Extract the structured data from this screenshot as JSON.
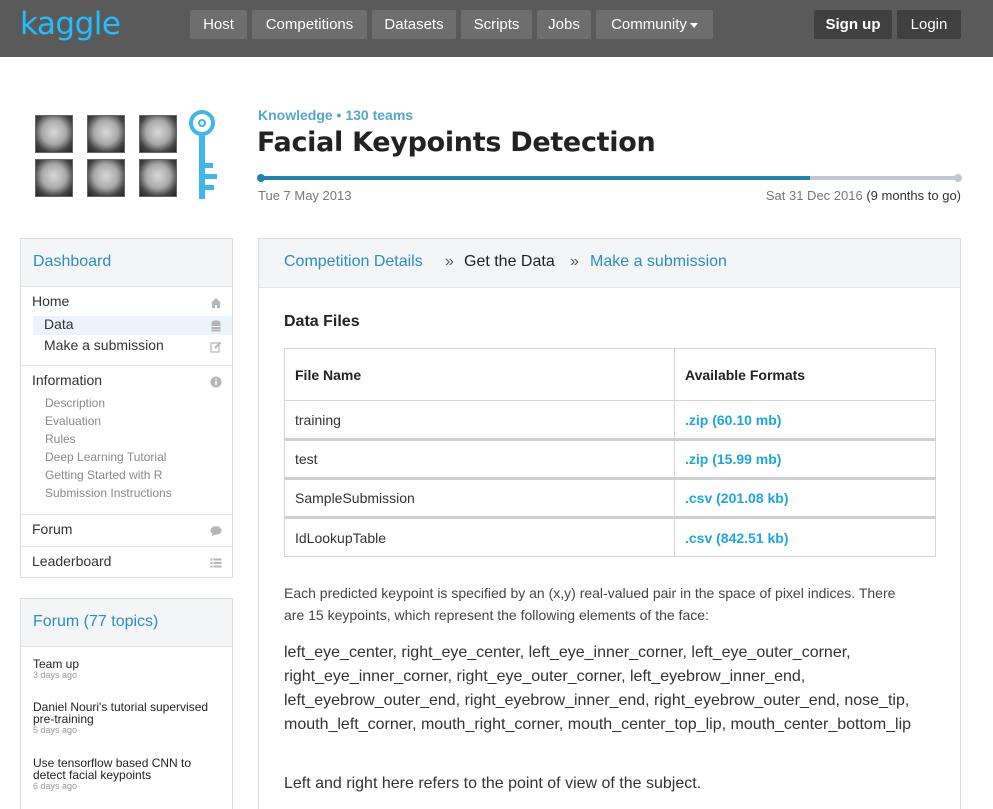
{
  "brand": {
    "logo": "kaggle",
    "accent": "#20beff"
  },
  "nav": {
    "items": [
      "Host",
      "Competitions",
      "Datasets",
      "Scripts",
      "Jobs",
      "Community"
    ],
    "signup": "Sign up",
    "login": "Login"
  },
  "competition": {
    "meta": "Knowledge • 130 teams",
    "title": "Facial Keypoints Detection",
    "start_date": "Tue 7 May 2013",
    "end_date": "Sat 31 Dec 2016",
    "remaining": "(9 months to go)",
    "progress": 0.785
  },
  "sidebar": {
    "dashboard_title": "Dashboard",
    "home": "Home",
    "data": "Data",
    "make_submission": "Make a submission",
    "information": "Information",
    "info_links": [
      "Description",
      "Evaluation",
      "Rules",
      "Deep Learning Tutorial",
      "Getting Started with R",
      "Submission Instructions"
    ],
    "forum": "Forum",
    "leaderboard": "Leaderboard"
  },
  "forum_box": {
    "title": "Forum (77 topics)",
    "topics": [
      {
        "title": "Team up",
        "ago": "3 days ago"
      },
      {
        "title": "Daniel Nouri's tutorial supervised pre-training",
        "ago": "5 days ago"
      },
      {
        "title": "Use tensorflow based CNN to detect facial keypoints",
        "ago": "6 days ago"
      }
    ]
  },
  "breadcrumb": {
    "details": "Competition Details",
    "sep": "»",
    "current": "Get the Data",
    "submit": "Make a submission"
  },
  "data_files": {
    "title": "Data Files",
    "col_name": "File Name",
    "col_formats": "Available Formats",
    "rows": [
      {
        "name": "training",
        "format": ".zip (60.10 mb)"
      },
      {
        "name": "test",
        "format": ".zip (15.99 mb)"
      },
      {
        "name": "SampleSubmission",
        "format": ".csv (201.08 kb)"
      },
      {
        "name": "IdLookupTable",
        "format": ".csv (842.51 kb)"
      }
    ]
  },
  "description": {
    "para1_line1": "Each predicted keypoint is specified by an (x,y) real-valued pair in the space of pixel indices. There",
    "para1_line2": "are 15 keypoints, which represent the following elements of the face:",
    "keypoints": "left_eye_center, right_eye_center, left_eye_inner_corner, left_eye_outer_corner, right_eye_inner_corner, right_eye_outer_corner, left_eyebrow_inner_end, left_eyebrow_outer_end, right_eyebrow_inner_end, right_eyebrow_outer_end, nose_tip, mouth_left_corner, mouth_right_corner, mouth_center_top_lip, mouth_center_bottom_lip",
    "note": "Left and right here refers to the point of view of the subject."
  }
}
